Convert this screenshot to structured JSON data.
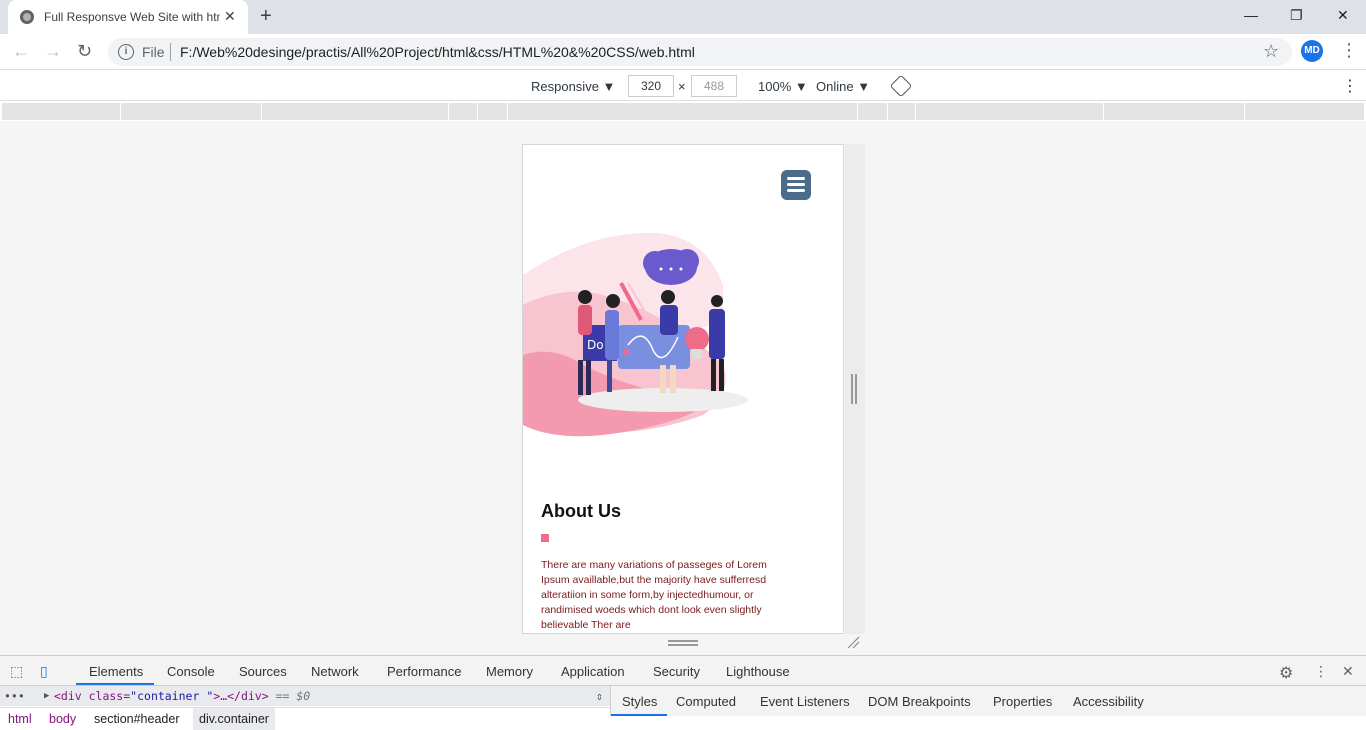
{
  "browser": {
    "tab_title": "Full Responsve Web Site with htm",
    "tab_close": "✕",
    "new_tab": "+",
    "url_scheme": "File",
    "url": "F:/Web%20desinge/practis/All%20Project/html&css/HTML%20&%20CSS/web.html",
    "avatar": "MD",
    "window_controls": {
      "minimize": "—",
      "maximize": "❐",
      "close": "✕"
    }
  },
  "device_toolbar": {
    "device": "Responsive",
    "width": "320",
    "height": "488",
    "times": "×",
    "zoom": "100%",
    "network": "Online"
  },
  "page": {
    "about_title": "About Us",
    "about_text": "There are many variations of passeges of Lorem Ipsum availlable,but the majority have sufferresd alteratiion in some form,by injectedhumour, or randimised woeds which dont look even slightly believable Ther are"
  },
  "devtools": {
    "tabs": [
      "Elements",
      "Console",
      "Sources",
      "Network",
      "Performance",
      "Memory",
      "Application",
      "Security",
      "Lighthouse"
    ],
    "dom_line": {
      "open": "<div class=",
      "class_value": "\"container \"",
      "rest": ">…</div>",
      "eq": "== $0"
    },
    "breadcrumbs": [
      "html",
      "body",
      "section#header",
      "div.container"
    ],
    "styles_tabs": [
      "Styles",
      "Computed",
      "Event Listeners",
      "DOM Breakpoints",
      "Properties",
      "Accessibility"
    ]
  },
  "colors": {
    "accent": "#1a73e8",
    "menu_button": "#4a6b8a",
    "about_marker": "#f06a8a",
    "body_text": "#7a1a1a"
  }
}
